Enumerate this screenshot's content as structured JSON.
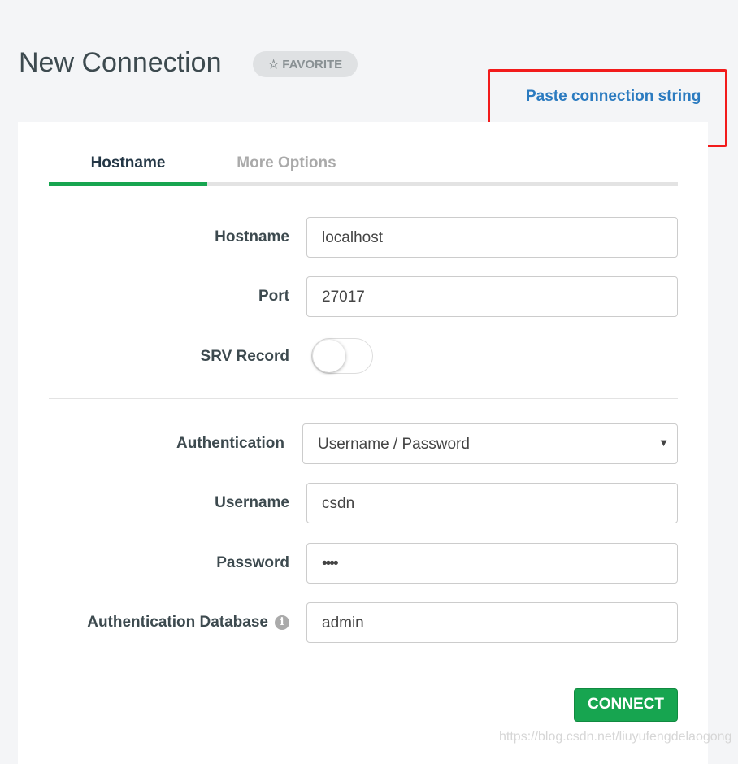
{
  "header": {
    "title": "New Connection",
    "favorite_label": "FAVORITE",
    "paste_link": "Paste connection string"
  },
  "tabs": [
    {
      "label": "Hostname",
      "active": true
    },
    {
      "label": "More Options",
      "active": false
    }
  ],
  "form": {
    "hostname": {
      "label": "Hostname",
      "value": "localhost"
    },
    "port": {
      "label": "Port",
      "value": "27017"
    },
    "srv": {
      "label": "SRV Record",
      "enabled": false
    },
    "authentication": {
      "label": "Authentication",
      "value": "Username / Password"
    },
    "username": {
      "label": "Username",
      "value": "csdn"
    },
    "password": {
      "label": "Password",
      "value": "••••"
    },
    "auth_db": {
      "label": "Authentication Database",
      "value": "admin"
    }
  },
  "connect_label": "CONNECT",
  "watermark": "https://blog.csdn.net/liuyufengdelaogong",
  "colors": {
    "accent": "#17a550",
    "link": "#2b7bc0",
    "highlight": "#f21b1b"
  }
}
